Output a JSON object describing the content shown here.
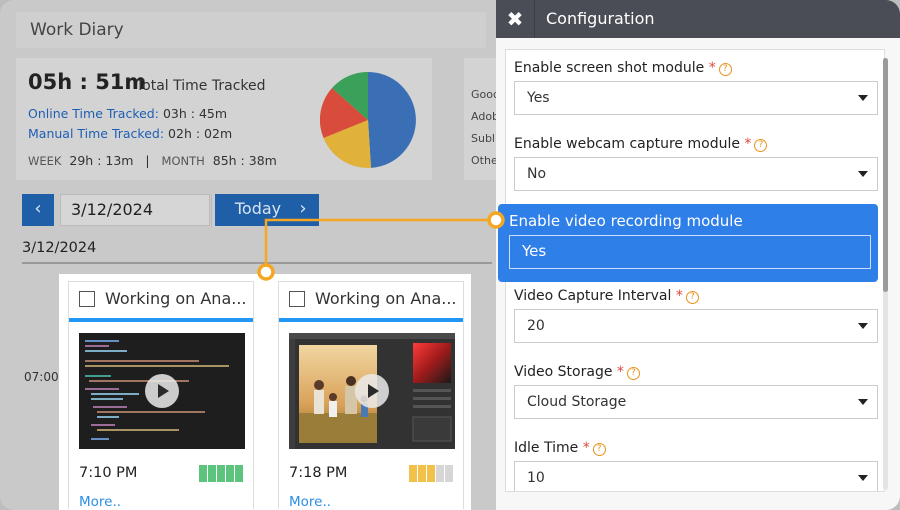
{
  "diary": {
    "title": "Work Diary",
    "total_time": "05h : 51m",
    "total_label": "Total Time Tracked",
    "online_label": "Online Time Tracked:",
    "online_value": "03h : 45m",
    "manual_label": "Manual Time Tracked:",
    "manual_value": "02h : 02m",
    "week_label": "WEEK",
    "week_value": "29h : 13m",
    "separator": "|",
    "month_label": "MONTH",
    "month_value": "85h : 38m",
    "side_items": [
      "Good",
      "Adob",
      "Subl",
      "Othe"
    ],
    "pie_colors": [
      "#3a6fb5",
      "#e0b23a",
      "#d94b3a",
      "#3aa05a"
    ],
    "nav_prev": "‹",
    "nav_next": "›",
    "date_value": "3/12/2024",
    "today_label": "Today",
    "date_heading": "3/12/2024",
    "time_row_label": "07:00"
  },
  "cards": [
    {
      "title": "Working on Ana...",
      "time": "7:10 PM",
      "more": "More..",
      "activity": [
        1,
        1,
        1,
        1,
        1
      ],
      "bar_color": "#5cc47d",
      "thumb": "code-editor"
    },
    {
      "title": "Working on Ana...",
      "time": "7:18 PM",
      "more": "More..",
      "activity": [
        1,
        1,
        1,
        0,
        0
      ],
      "bar_color": "#f2c14b",
      "thumb": "photo-editor"
    }
  ],
  "config": {
    "title": "Configuration",
    "close_icon": "close-icon",
    "fields": [
      {
        "label": "Enable screen shot module",
        "value": "Yes"
      },
      {
        "label": "Enable webcam capture module",
        "value": "No"
      },
      {
        "label": "Enable video recording module",
        "value": "Yes"
      },
      {
        "label": "Video Capture Interval",
        "value": "20"
      },
      {
        "label": "Video Storage",
        "value": "Cloud Storage"
      },
      {
        "label": "Idle Time",
        "value": "10"
      }
    ],
    "required_mark": "*",
    "help_mark": "?",
    "accent": "#2f7fe8",
    "connector_color": "#f5a623"
  }
}
